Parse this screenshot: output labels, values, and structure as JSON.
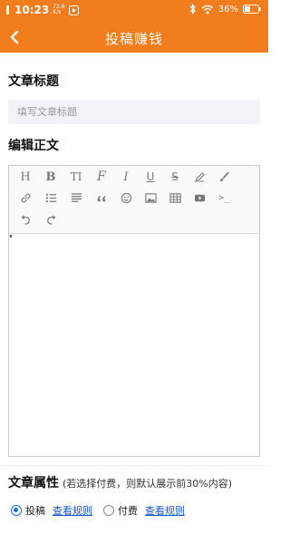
{
  "status_bar": {
    "time": "10:23",
    "net_speed_top": "72.6",
    "net_speed_bottom": "K/s",
    "battery": "36%"
  },
  "app_bar": {
    "title": "投稿赚钱"
  },
  "article_title": {
    "label": "文章标题",
    "placeholder": "填写文章标题",
    "value": ""
  },
  "body_editor": {
    "label": "编辑正文",
    "toolbar": [
      "heading-icon",
      "bold-icon",
      "text-size-icon",
      "font-icon",
      "italic-icon",
      "underline-icon",
      "strikethrough-icon",
      "pencil-icon",
      "brush-icon",
      "link-icon",
      "bullet-list-icon",
      "align-icon",
      "quote-icon",
      "emoji-icon",
      "image-icon",
      "table-icon",
      "video-icon",
      "code-icon",
      "undo-icon",
      "redo-icon"
    ],
    "toolbar_text": {
      "heading": "H",
      "bold": "B",
      "text_size": "TI",
      "font": "F",
      "italic": "I",
      "underline": "U",
      "strike": "S",
      "code": ">_"
    }
  },
  "article_attr": {
    "label": "文章属性",
    "note": "(若选择付费，则默认展示前30%内容)",
    "options": [
      {
        "label": "投稿",
        "selected": true,
        "rule_link": "查看规则"
      },
      {
        "label": "付费",
        "selected": false,
        "rule_link": "查看规则"
      }
    ]
  },
  "colors": {
    "accent": "#f27d1d",
    "link": "#1a56c8",
    "radio_selected": "#1a73e8"
  }
}
